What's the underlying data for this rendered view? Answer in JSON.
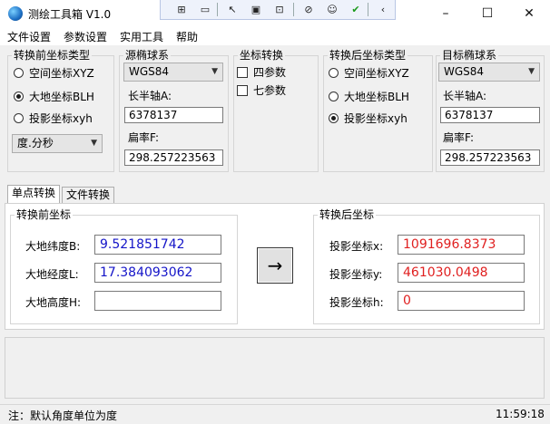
{
  "window": {
    "title": "测绘工具箱 V1.0"
  },
  "menu": [
    "文件设置",
    "参数设置",
    "实用工具",
    "帮助"
  ],
  "source_type": {
    "title": "转换前坐标类型",
    "options": [
      "空间坐标XYZ",
      "大地坐标BLH",
      "投影坐标xyh"
    ],
    "selected": "大地坐标BLH",
    "angle_format": "度.分秒"
  },
  "source_ellipsoid": {
    "title": "源椭球系",
    "ellipsoid": "WGS84",
    "semi_major_label": "长半轴A:",
    "semi_major_value": "6378137",
    "flattening_label": "扁率F:",
    "flattening_value": "298.257223563"
  },
  "coord_transform": {
    "title": "坐标转换",
    "options": [
      "四参数",
      "七参数"
    ]
  },
  "target_type": {
    "title": "转换后坐标类型",
    "options": [
      "空间坐标XYZ",
      "大地坐标BLH",
      "投影坐标xyh"
    ],
    "selected": "投影坐标xyh"
  },
  "target_ellipsoid": {
    "title": "目标椭球系",
    "ellipsoid": "WGS84",
    "semi_major_label": "长半轴A:",
    "semi_major_value": "6378137",
    "flattening_label": "扁率F:",
    "flattening_value": "298.257223563"
  },
  "tabs": [
    "单点转换",
    "文件转换"
  ],
  "input": {
    "title": "转换前坐标",
    "latitude_label": "大地纬度B:",
    "latitude_value": "9.521851742",
    "longitude_label": "大地经度L:",
    "longitude_value": "17.384093062",
    "height_label": "大地高度H:",
    "height_value": ""
  },
  "convert_symbol": "→",
  "output": {
    "title": "转换后坐标",
    "x_label": "投影坐标x:",
    "x_value": "1091696.8373",
    "y_label": "投影坐标y:",
    "y_value": "461030.0498",
    "h_label": "投影坐标h:",
    "h_value": "0"
  },
  "status": {
    "note": "注：默认角度单位为度",
    "time": "11:59:18"
  },
  "colors": {
    "input_value": "#1414c8",
    "output_value": "#e02020"
  }
}
